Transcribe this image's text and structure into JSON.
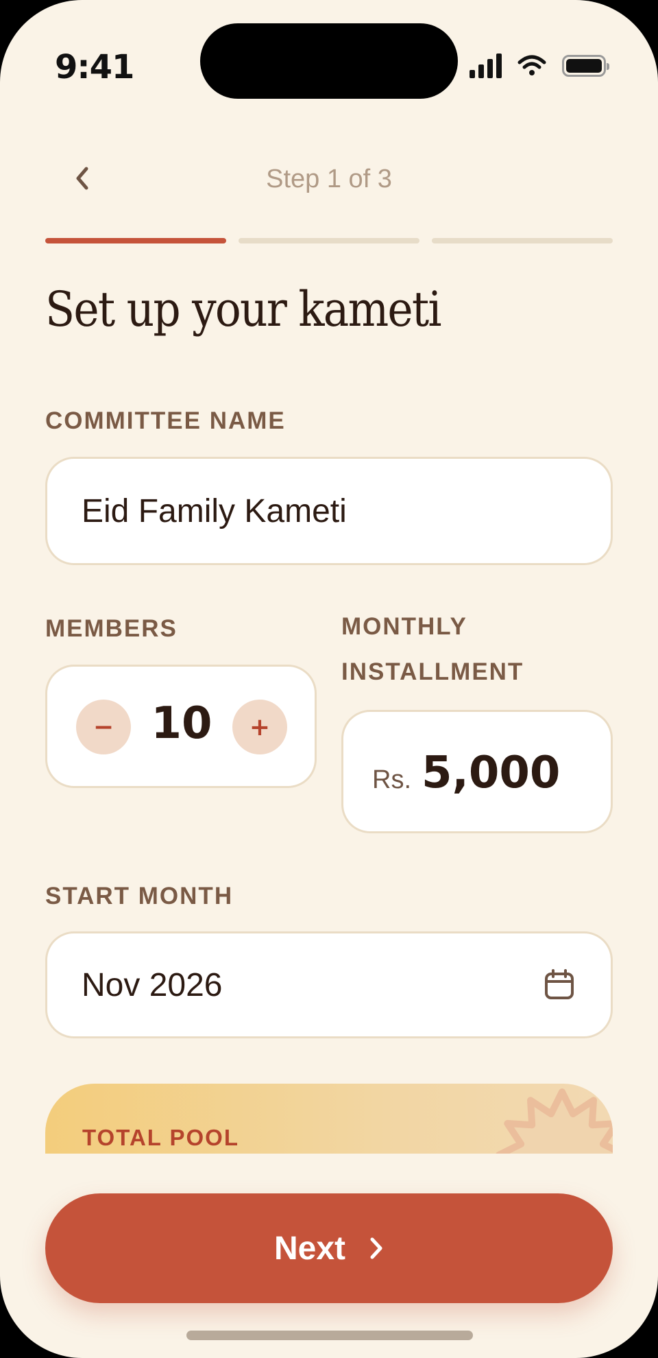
{
  "status_bar": {
    "time": "9:41"
  },
  "header": {
    "step_text": "Step 1 of 3",
    "progress": {
      "current_step": 1,
      "total_steps": 3
    }
  },
  "title": "Set up your kameti",
  "committee": {
    "label": "COMMITTEE NAME",
    "value": "Eid Family Kameti"
  },
  "members": {
    "label": "MEMBERS",
    "value": "10",
    "minus": "−",
    "plus": "+"
  },
  "installment": {
    "label": "MONTHLY INSTALLMENT",
    "currency": "Rs.",
    "amount": "5,000"
  },
  "start_month": {
    "label": "START MONTH",
    "value": "Nov 2026"
  },
  "pool": {
    "label": "TOTAL POOL"
  },
  "next_button": {
    "label": "Next"
  },
  "colors": {
    "accent": "#C5533A",
    "background": "#FAF3E7",
    "card_border": "#EADCC5",
    "label": "#7A5A45"
  },
  "icons": [
    "back-chevron-icon",
    "calendar-icon",
    "chevron-right-icon",
    "burst-decoration-icon",
    "signal-icon",
    "wifi-icon",
    "battery-icon"
  ]
}
